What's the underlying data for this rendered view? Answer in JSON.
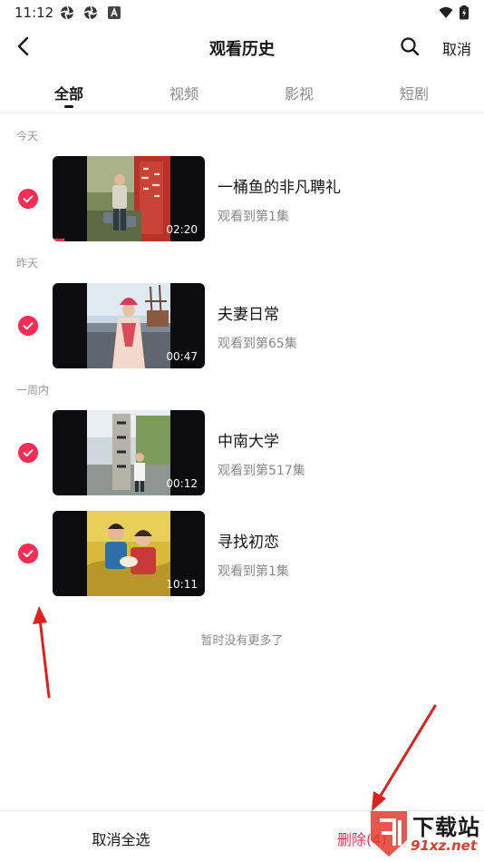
{
  "status_bar": {
    "time": "11:12"
  },
  "header": {
    "title": "观看历史",
    "cancel_label": "取消"
  },
  "tabs": [
    {
      "label": "全部",
      "active": true
    },
    {
      "label": "视频",
      "active": false
    },
    {
      "label": "影视",
      "active": false
    },
    {
      "label": "短剧",
      "active": false
    }
  ],
  "sections": [
    {
      "label": "今天"
    },
    {
      "label": "昨天"
    },
    {
      "label": "一周内"
    }
  ],
  "items": [
    {
      "title": "一桶鱼的非凡聘礼",
      "subtitle": "观看到第1集",
      "duration": "02:20",
      "selected": true,
      "progress": 0.08
    },
    {
      "title": "夫妻日常",
      "subtitle": "观看到第65集",
      "duration": "00:47",
      "selected": true,
      "progress": 0
    },
    {
      "title": "中南大学",
      "subtitle": "观看到第517集",
      "duration": "00:12",
      "selected": true,
      "progress": 0
    },
    {
      "title": "寻找初恋",
      "subtitle": "观看到第1集",
      "duration": "10:11",
      "selected": true,
      "progress": 0
    }
  ],
  "footer_note": "暂时没有更多了",
  "bottom_bar": {
    "cancel_all_label": "取消全选",
    "delete_label": "删除(4)"
  },
  "watermark": {
    "text_top": "下载站",
    "text_bottom": "91xz.net"
  },
  "colors": {
    "accent": "#fe2c55",
    "annotation_arrow": "#e0211b"
  }
}
